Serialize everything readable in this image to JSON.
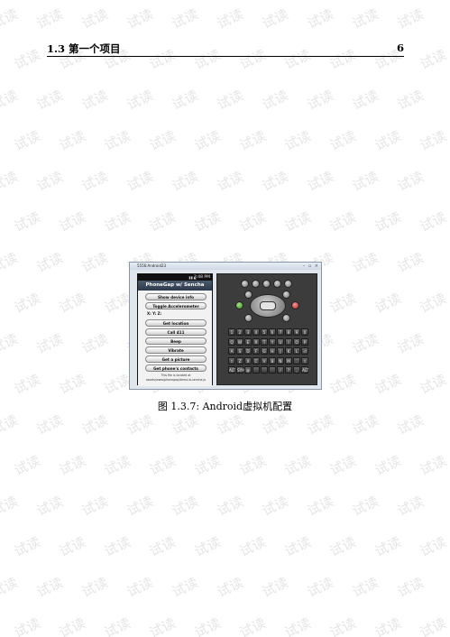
{
  "header": {
    "section": "1.3 第一个项目",
    "page_number": "6"
  },
  "watermark_text": "试读",
  "figure": {
    "window_title": "5556:Android23",
    "window_buttons": "– ▫ ×",
    "status_time": "3:48 PM",
    "status_icons": "▮▮ ◣",
    "app_title": "PhoneGap w/ Sencha Touch",
    "buttons": [
      "Show device info",
      "Toggle Accelerometer",
      "Get location",
      "Call 411",
      "Beep",
      "Vibrate",
      "Get a picture",
      "Get phone's contacts"
    ],
    "xyz_label": "X:    Y:    Z:",
    "footer_lines": [
      "This file is located at",
      "assets/www/phonegap/demo-w-sencha.js"
    ],
    "keyboard_rows": [
      [
        "1",
        "2",
        "3",
        "4",
        "5",
        "6",
        "7",
        "8",
        "9",
        "0"
      ],
      [
        "Q",
        "W",
        "E",
        "R",
        "T",
        "Y",
        "U",
        "I",
        "O",
        "P"
      ],
      [
        "A",
        "S",
        "D",
        "F",
        "G",
        "H",
        "J",
        "K",
        "L",
        "⏎"
      ],
      [
        "⇧",
        "Z",
        "X",
        "C",
        "V",
        "B",
        "N",
        "M",
        ".",
        "⇧"
      ],
      [
        "ALT",
        "SYM",
        "@",
        "",
        "",
        "",
        "/",
        "?",
        ",",
        "ALT"
      ]
    ]
  },
  "caption": "图 1.3.7: Android虚拟机配置"
}
